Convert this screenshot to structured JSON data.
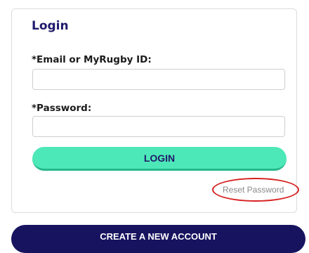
{
  "login_form": {
    "title": "Login",
    "email_label": "*Email or MyRugby ID:",
    "email_value": "",
    "password_label": "*Password:",
    "password_value": "",
    "login_button": "LOGIN",
    "reset_link": "Reset Password"
  },
  "create_account_button": "CREATE A NEW ACCOUNT",
  "colors": {
    "title": "#1f1a6b",
    "login_button": "#4de8b7",
    "create_button": "#17135f",
    "highlight_circle": "#d62020"
  }
}
